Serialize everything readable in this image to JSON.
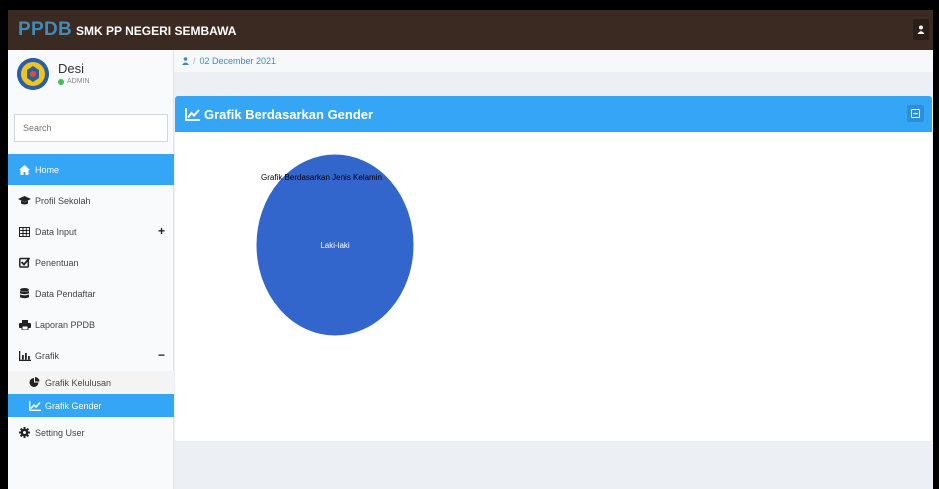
{
  "header": {
    "brand_main": "PPDB",
    "brand_sub": "SMK PP NEGERI SEMBAWA"
  },
  "user": {
    "name": "Desi",
    "role": "ADMIN"
  },
  "search": {
    "placeholder": "Search"
  },
  "sidebar": {
    "items": [
      {
        "label": "Home",
        "icon": "home-icon"
      },
      {
        "label": "Profil Sekolah",
        "icon": "graduation-cap-icon"
      },
      {
        "label": "Data Input",
        "icon": "table-icon",
        "toggle": "+"
      },
      {
        "label": "Penentuan",
        "icon": "check-square-icon"
      },
      {
        "label": "Data Pendaftar",
        "icon": "database-icon"
      },
      {
        "label": "Laporan PPDB",
        "icon": "printer-icon"
      },
      {
        "label": "Grafik",
        "icon": "bar-chart-icon",
        "toggle": "−"
      }
    ],
    "subitems": [
      {
        "label": "Grafik Kelulusan",
        "icon": "pie-chart-icon"
      },
      {
        "label": "Grafik Gender",
        "icon": "line-chart-icon"
      }
    ],
    "setting": {
      "label": "Setting User",
      "icon": "gear-icon"
    }
  },
  "breadcrumb": {
    "date": "02 December 2021"
  },
  "panel": {
    "title": "Grafik Berdasarkan Gender"
  },
  "chart_data": {
    "type": "pie",
    "title": "Grafik Berdasarkan Jenis Kelamin",
    "slices": [
      {
        "label": "Laki-laki",
        "value": 100,
        "color": "#3366cc"
      }
    ]
  },
  "colors": {
    "topbar": "#3b2a22",
    "accent": "#35a5f5",
    "brand": "#3c8dbc"
  }
}
